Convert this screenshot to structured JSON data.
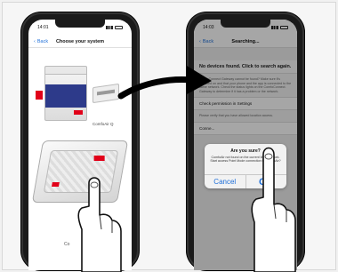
{
  "left_phone": {
    "status_time": "14:01",
    "nav": {
      "back_label": "Back",
      "title": "Choose your system"
    },
    "product_label": "ComfoAir Q",
    "bottom_label": "Co"
  },
  "right_phone": {
    "status_time": "14:03",
    "nav": {
      "back_label": "Back",
      "title": "Searching..."
    },
    "no_devices": "No devices found. Click to search again.",
    "info_text": "ComfoConnect Gateway cannot be found? Make sure it's switched on and that your phone and the app is connected to the same network. Check the status lights on the ComfoConnect. Gateway to determine if it has a problem or the network.",
    "permission_row": "Check permission in Settings",
    "permission_sub": "Please verify that you have allowed location access.",
    "connect_row": "Conne...",
    "alert": {
      "title": "Are you sure?",
      "message": "ComfoAir not found on the current WiFi network. Start access Point Mode connection to ComfoAir?",
      "cancel_label": "Cancel",
      "ok_label": "OK"
    }
  },
  "colors": {
    "ios_blue": "#1e6fd9",
    "zehnder_red": "#e10019",
    "unit_blue": "#2d3a8a"
  }
}
